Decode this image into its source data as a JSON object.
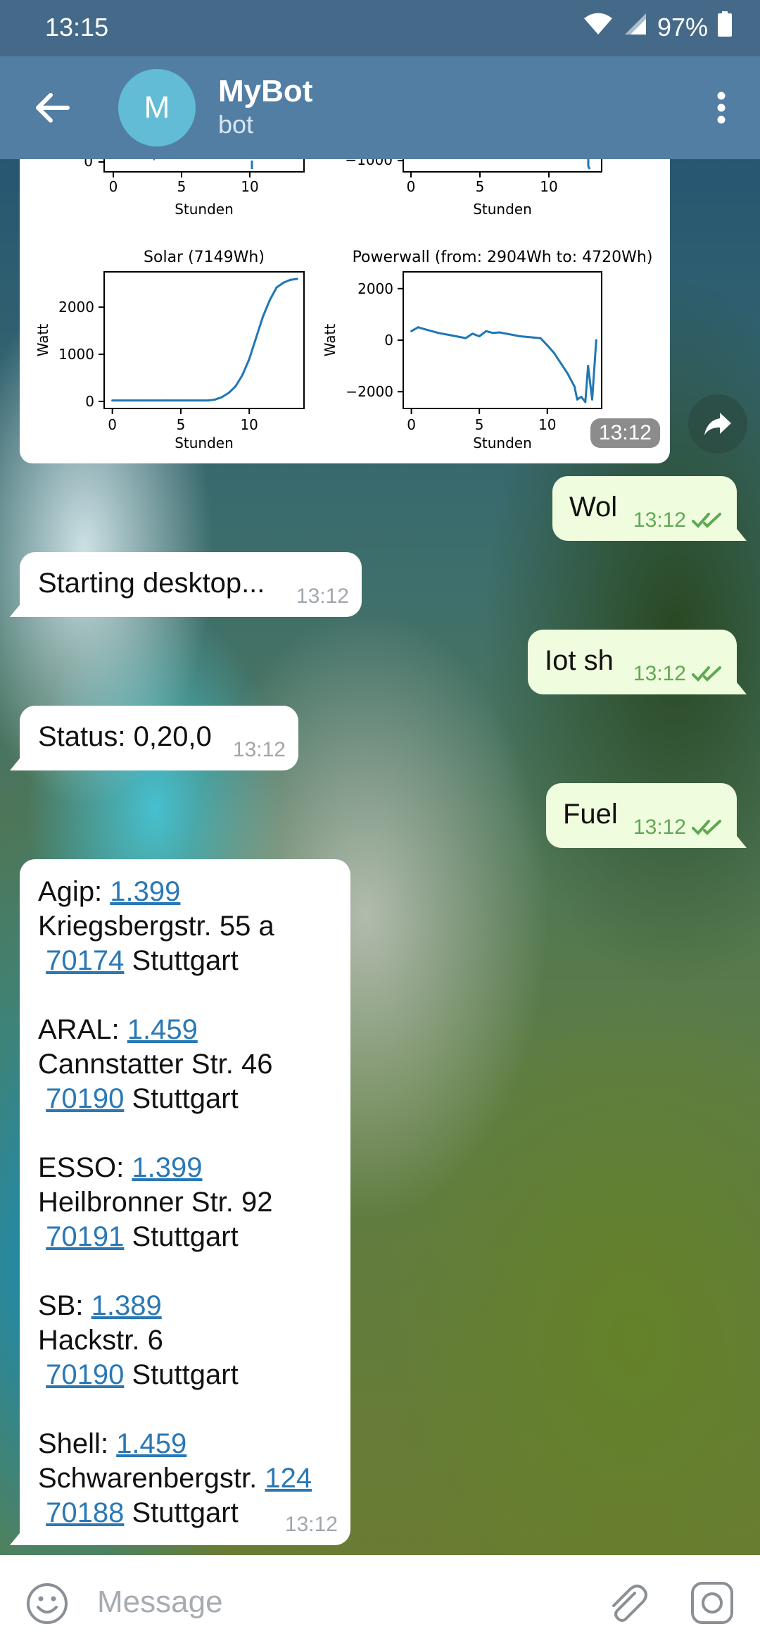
{
  "status_bar": {
    "time": "13:15",
    "battery": "97%"
  },
  "header": {
    "back_icon": "arrow-left-icon",
    "avatar_letter": "M",
    "title": "MyBot",
    "subtitle": "bot",
    "menu_icon": "more-vertical-icon"
  },
  "photo_message": {
    "time": "13:12",
    "charts": [
      {
        "title": "",
        "xlabel": "Stunden",
        "x_ticks": [
          "0",
          "5",
          "10"
        ],
        "y_ticks": [
          "0"
        ]
      },
      {
        "title": "",
        "xlabel": "Stunden",
        "x_ticks": [
          "0",
          "5",
          "10"
        ],
        "y_ticks": [
          "−1000"
        ]
      },
      {
        "title": "Solar (7149Wh)",
        "xlabel": "Stunden",
        "ylabel": "Watt",
        "x_ticks": [
          "0",
          "5",
          "10"
        ],
        "y_ticks": [
          "0",
          "1000",
          "2000"
        ]
      },
      {
        "title": "Powerwall (from: 2904Wh to: 4720Wh)",
        "xlabel": "Stunden",
        "ylabel": "Watt",
        "x_ticks": [
          "0",
          "5",
          "10"
        ],
        "y_ticks": [
          "−2000",
          "0",
          "2000"
        ]
      }
    ]
  },
  "chart_data": [
    {
      "type": "line",
      "title": "Solar (7149Wh)",
      "xlabel": "Stunden",
      "ylabel": "Watt",
      "xlim": [
        -0.6,
        14
      ],
      "ylim": [
        -150,
        2750
      ],
      "x": [
        0,
        1,
        2,
        3,
        4,
        5,
        6,
        7,
        7.5,
        8,
        8.5,
        9,
        9.5,
        10,
        10.5,
        11,
        11.5,
        12,
        12.5,
        13,
        13.5
      ],
      "y": [
        20,
        20,
        20,
        20,
        20,
        20,
        20,
        20,
        40,
        90,
        180,
        320,
        560,
        900,
        1350,
        1800,
        2150,
        2420,
        2520,
        2580,
        2600
      ],
      "color": "#1f77b4"
    },
    {
      "type": "line",
      "title": "Powerwall (from: 2904Wh to: 4720Wh)",
      "xlabel": "Stunden",
      "ylabel": "Watt",
      "xlim": [
        -0.6,
        14
      ],
      "ylim": [
        -2650,
        2650
      ],
      "x": [
        0,
        0.5,
        1,
        2,
        3,
        4,
        4.5,
        5,
        5.5,
        6,
        6.5,
        7,
        8,
        9,
        9.5,
        10,
        10.5,
        11,
        11.5,
        12,
        12.2,
        12.5,
        12.8,
        13,
        13.3,
        13.6
      ],
      "y": [
        350,
        500,
        420,
        280,
        180,
        80,
        250,
        150,
        350,
        280,
        300,
        250,
        150,
        100,
        80,
        -200,
        -500,
        -900,
        -1300,
        -1800,
        -2300,
        -2200,
        -2400,
        -1000,
        -2300,
        0
      ],
      "color": "#1f77b4"
    }
  ],
  "messages": [
    {
      "dir": "out",
      "text": "Wol",
      "time": "13:12"
    },
    {
      "dir": "in",
      "text": "Starting desktop...",
      "time": "13:12"
    },
    {
      "dir": "out",
      "text": "Iot sh",
      "time": "13:12"
    },
    {
      "dir": "in",
      "text": "Status: 0,20,0",
      "time": "13:12"
    },
    {
      "dir": "out",
      "text": "Fuel",
      "time": "13:12"
    }
  ],
  "fuel": {
    "time": "13:12",
    "stations": [
      {
        "name": "Agip:",
        "price": "1.399",
        "street": "Kriegsbergstr. 55 a",
        "street_link": "",
        "zip": "70174",
        "city": "Stuttgart"
      },
      {
        "name": "ARAL:",
        "price": "1.459",
        "street": "Cannstatter Str. 46",
        "street_link": "",
        "zip": "70190",
        "city": "Stuttgart"
      },
      {
        "name": "ESSO:",
        "price": "1.399",
        "street": "Heilbronner Str. 92",
        "street_link": "",
        "zip": "70191",
        "city": "Stuttgart"
      },
      {
        "name": "SB:",
        "price": "1.389",
        "street": "Hackstr. 6",
        "street_link": "",
        "zip": "70190",
        "city": "Stuttgart"
      },
      {
        "name": "Shell:",
        "price": "1.459",
        "street": "Schwarenbergstr.",
        "street_link": "124",
        "zip": "70188",
        "city": "Stuttgart"
      }
    ]
  },
  "input": {
    "placeholder": "Message"
  }
}
